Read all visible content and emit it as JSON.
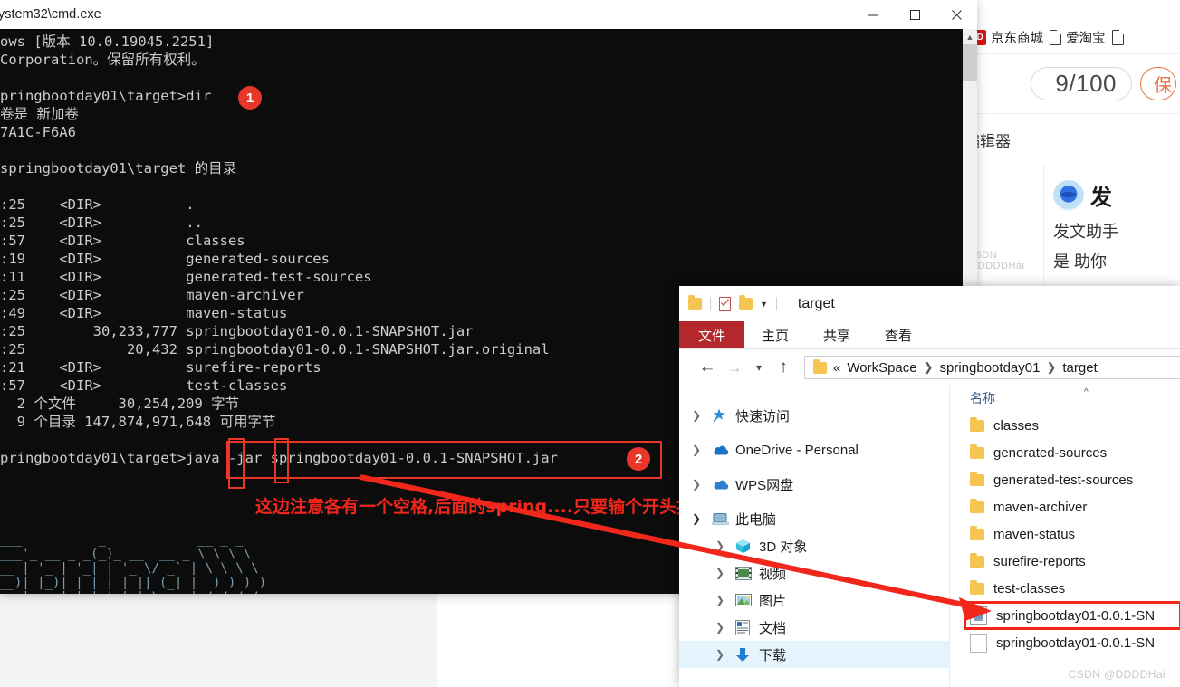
{
  "browser": {
    "bookmarks": [
      {
        "icon": "jd-logo-icon",
        "label": "京东商城"
      },
      {
        "icon": "page-icon",
        "label": "爱淘宝"
      },
      {
        "icon": "page-icon",
        "label": ""
      }
    ],
    "counter": "9/100",
    "save_button": "保",
    "editor_label": "文编辑器",
    "assistant_title": "发",
    "assistant_line1": "发文助手",
    "assistant_line2": "是  助你",
    "watermark": "CSDN @DDDDHai"
  },
  "cmd": {
    "title": "ystem32\\cmd.exe",
    "minimize": "minimize-icon",
    "maximize": "maximize-icon",
    "close": "close-icon",
    "lines": [
      "ows [版本 10.0.19045.2251]",
      "Corporation。保留所有权利。",
      "",
      "pringbootday01\\target>dir",
      "卷是 新加卷",
      "7A1C-F6A6",
      "",
      "springbootday01\\target 的目录",
      "",
      ":25    <DIR>          .",
      ":25    <DIR>          ..",
      ":57    <DIR>          classes",
      ":19    <DIR>          generated-sources",
      ":11    <DIR>          generated-test-sources",
      ":25    <DIR>          maven-archiver",
      ":49    <DIR>          maven-status",
      ":25        30,233,777 springbootday01-0.0.1-SNAPSHOT.jar",
      ":25            20,432 springbootday01-0.0.1-SNAPSHOT.jar.original",
      ":21    <DIR>          surefire-reports",
      ":57    <DIR>          test-classes",
      "  2 个文件     30,254,209 字节",
      "  9 个目录 147,874,971,648 可用字节",
      "",
      "pringbootday01\\target>java -jar springbootday01-0.0.1-SNAPSHOT.jar"
    ],
    "banner": [
      "  .   ____          _            __ _ _",
      " /\\\\ / ___'_ __ _ _(_)_ __  __ _ \\ \\ \\ \\",
      "( ( )\\___ | '_ | '_| | '_ \\/ _` | \\ \\ \\ \\",
      " \\\\/  ___)| |_)| | | | | || (_| |  ) ) ) )",
      "  '  |____| .__|_| |_|_| |_\\__, | / / / /"
    ],
    "annotations": {
      "badge1": "1",
      "badge2": "2",
      "note": "这边注意各有一个空格,后面的spring....只要输个开头按tap就可以补齐",
      "note_color": "#f2271c"
    }
  },
  "explorer": {
    "title": "target",
    "quick_access": [
      "folder-icon",
      "properties-icon",
      "new-folder-icon",
      "chevron-down-icon"
    ],
    "ribbon_tabs": [
      "文件",
      "主页",
      "共享",
      "查看"
    ],
    "nav_buttons": {
      "back": "back-arrow-icon",
      "forward": "forward-arrow-icon",
      "recent": "chevron-down-icon",
      "up": "up-arrow-icon"
    },
    "breadcrumb": [
      "WorkSpace",
      "springbootday01",
      "target"
    ],
    "breadcrumb_prefix": "«",
    "nav_tree": [
      {
        "label": "快速访问",
        "icon": "star-pin-icon",
        "indent": 0,
        "expanded": false
      },
      {
        "label": "OneDrive - Personal",
        "icon": "onedrive-cloud-icon",
        "indent": 0,
        "expanded": false
      },
      {
        "label": "WPS网盘",
        "icon": "wps-cloud-icon",
        "indent": 0,
        "expanded": false
      },
      {
        "label": "此电脑",
        "icon": "this-pc-icon",
        "indent": 0,
        "expanded": true
      },
      {
        "label": "3D 对象",
        "icon": "3d-objects-icon",
        "indent": 1,
        "expanded": false
      },
      {
        "label": "视频",
        "icon": "videos-icon",
        "indent": 1,
        "expanded": false
      },
      {
        "label": "图片",
        "icon": "pictures-icon",
        "indent": 1,
        "expanded": false
      },
      {
        "label": "文档",
        "icon": "documents-icon",
        "indent": 1,
        "expanded": false
      },
      {
        "label": "下载",
        "icon": "downloads-icon",
        "indent": 1,
        "expanded": false,
        "highlight": true
      }
    ],
    "column_header": "名称",
    "sort_indicator": "^",
    "files": [
      {
        "name": "classes",
        "type": "folder"
      },
      {
        "name": "generated-sources",
        "type": "folder"
      },
      {
        "name": "generated-test-sources",
        "type": "folder"
      },
      {
        "name": "maven-archiver",
        "type": "folder"
      },
      {
        "name": "maven-status",
        "type": "folder"
      },
      {
        "name": "surefire-reports",
        "type": "folder"
      },
      {
        "name": "test-classes",
        "type": "folder"
      },
      {
        "name": "springbootday01-0.0.1-SN",
        "type": "jar",
        "highlighted": true
      },
      {
        "name": "springbootday01-0.0.1-SN",
        "type": "file"
      }
    ],
    "watermark": "CSDN @DDDDHai"
  },
  "colors": {
    "cmd_background": "#0c0c0c",
    "cmd_text": "#cccccc",
    "annotation_red": "#f2271c",
    "badge_red": "#e8362a",
    "ribbon_file_red": "#b4282c",
    "selection_blue": "#e5f3fd"
  }
}
